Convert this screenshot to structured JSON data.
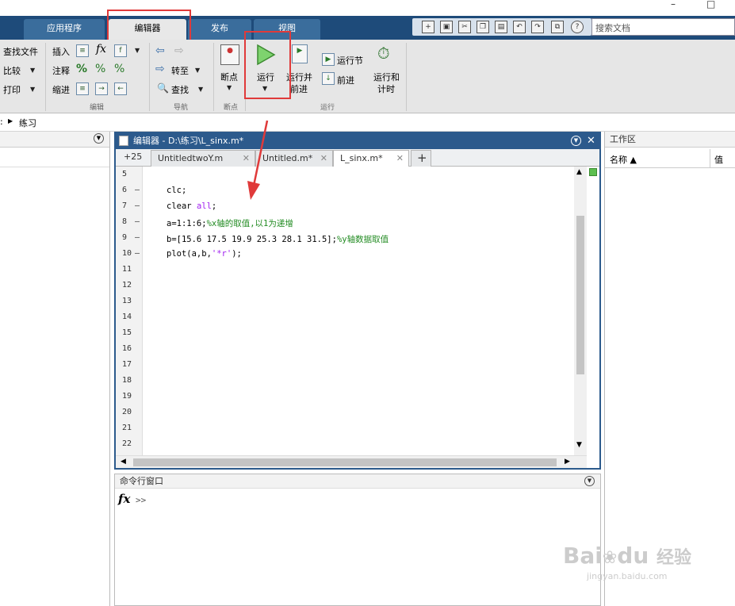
{
  "window": {
    "minimize": "–",
    "maximize": "□"
  },
  "tabs": {
    "apps": "应用程序",
    "editor": "编辑器",
    "publish": "发布",
    "view": "视图"
  },
  "search": {
    "placeholder": "搜索文档"
  },
  "ribbon": {
    "file": {
      "find_files": "查找文件",
      "compare": "比较",
      "print": "打印"
    },
    "edit": {
      "insert": "插入",
      "comment": "注释",
      "indent": "缩进",
      "label": "编辑"
    },
    "navigate": {
      "goto": "转至",
      "find": "查找",
      "label": "导航"
    },
    "breakpoints": {
      "label_btn": "断点",
      "label": "断点"
    },
    "run": {
      "run": "运行",
      "run_advance_1": "运行并",
      "run_advance_2": "前进",
      "run_section": "运行节",
      "advance": "前进",
      "run_time_1": "运行和",
      "run_time_2": "计时",
      "label": "运行"
    }
  },
  "addressbar": {
    "sep": ":",
    "folder": "练习"
  },
  "editor": {
    "title": "编辑器 - D:\\练习\\L_sinx.m*",
    "more_tabs": "+25",
    "tabs": [
      "UntitledtwoY.m",
      "Untitled.m*",
      "L_sinx.m*"
    ],
    "add_tab": "+",
    "line_numbers": [
      "5",
      "6",
      "7",
      "8",
      "9",
      "10",
      "11",
      "12",
      "13",
      "14",
      "15",
      "16",
      "17",
      "18",
      "19",
      "20",
      "21",
      "22"
    ],
    "code": {
      "l6": "clc;",
      "l7a": "clear ",
      "l7b": "all",
      "l7c": ";",
      "l8a": "a=1:1:6;",
      "l8b": "%x轴的取值,以1为递增",
      "l9a": "b=[15.6 17.5 19.9 25.3 28.1 31.5];",
      "l9b": "%y轴数据取值",
      "l10a": "plot(a,b,",
      "l10b": "'*r'",
      "l10c": ");"
    }
  },
  "command": {
    "title": "命令行窗口",
    "fx": "fx",
    "prompt": ">>"
  },
  "workspace": {
    "title": "工作区",
    "col_name": "名称 ▲",
    "col_value": "值"
  },
  "watermark": {
    "brand": "Bai",
    "brand2": "du",
    "jingyan": "经验",
    "url": "jingyan.baidu.com"
  }
}
